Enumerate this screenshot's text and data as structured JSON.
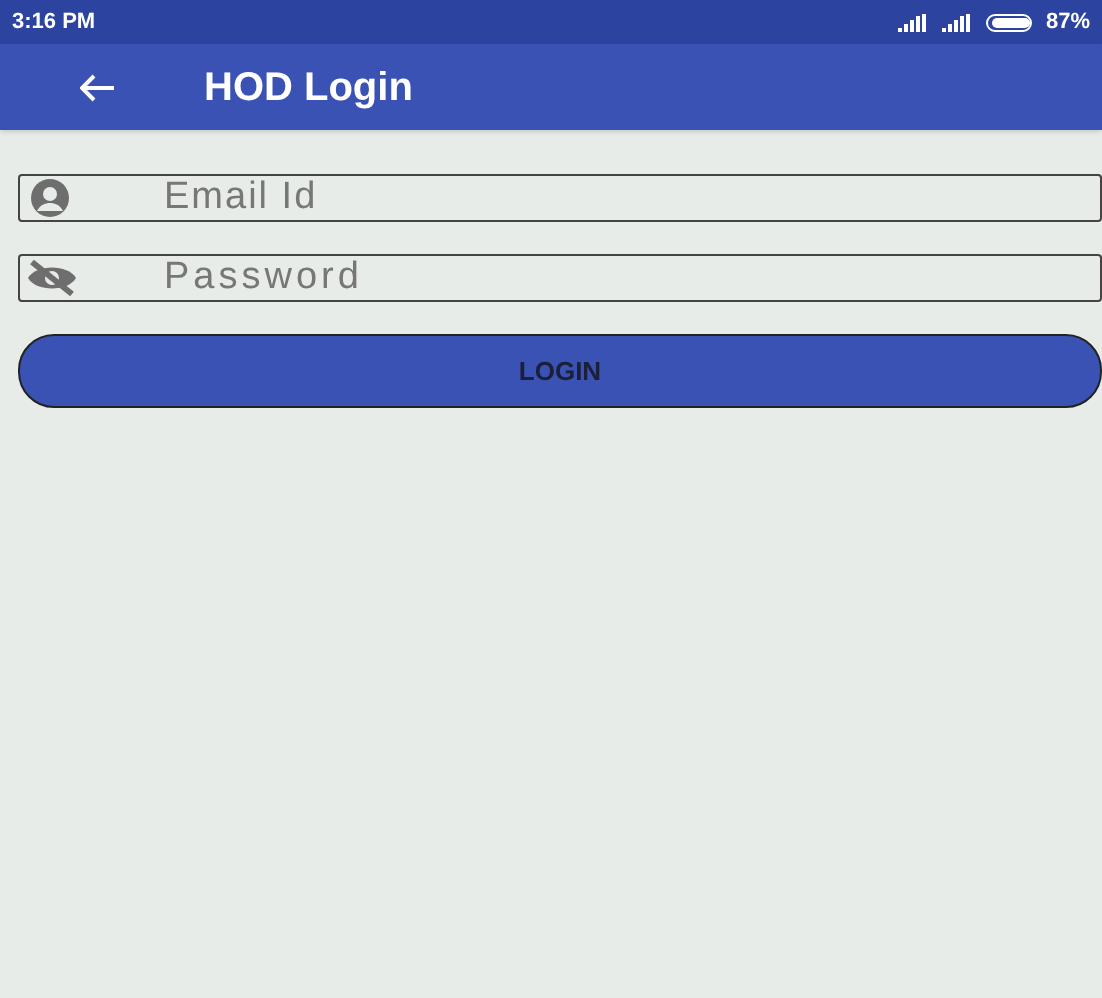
{
  "status_bar": {
    "time": "3:16 PM",
    "battery": "87%"
  },
  "app_bar": {
    "title": "HOD Login"
  },
  "fields": [
    {
      "kind": "email",
      "placeholder": "Email Id"
    },
    {
      "kind": "password",
      "placeholder": "Password"
    }
  ],
  "login_button": {
    "label": "LOGIN"
  }
}
